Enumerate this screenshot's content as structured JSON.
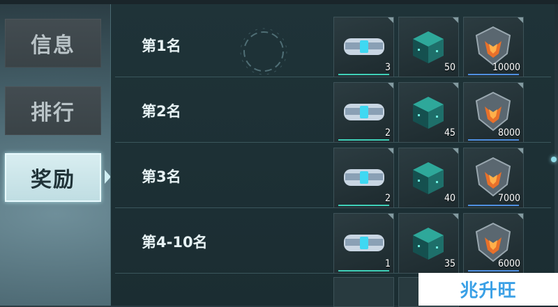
{
  "tabs": [
    {
      "label": "信息",
      "active": false
    },
    {
      "label": "排行",
      "active": false
    },
    {
      "label": "奖励",
      "active": true
    }
  ],
  "rewards": [
    {
      "rank": "第1名",
      "items": [
        {
          "icon": "chip-capsule-icon",
          "count": "3"
        },
        {
          "icon": "teal-cube-icon",
          "count": "50"
        },
        {
          "icon": "rank-emblem-icon",
          "count": "10000"
        }
      ]
    },
    {
      "rank": "第2名",
      "items": [
        {
          "icon": "chip-capsule-icon",
          "count": "2"
        },
        {
          "icon": "teal-cube-icon",
          "count": "45"
        },
        {
          "icon": "rank-emblem-icon",
          "count": "8000"
        }
      ]
    },
    {
      "rank": "第3名",
      "items": [
        {
          "icon": "chip-capsule-icon",
          "count": "2"
        },
        {
          "icon": "teal-cube-icon",
          "count": "40"
        },
        {
          "icon": "rank-emblem-icon",
          "count": "7000"
        }
      ]
    },
    {
      "rank": "第4-10名",
      "items": [
        {
          "icon": "chip-capsule-icon",
          "count": "1"
        },
        {
          "icon": "teal-cube-icon",
          "count": "35"
        },
        {
          "icon": "rank-emblem-icon",
          "count": "6000"
        }
      ]
    }
  ],
  "watermark": "兆升旺",
  "colors": {
    "item_bar_teal": "#3fd0b8",
    "item_bar_blue": "#4f8fe0",
    "active_tab": "#cfe9ee"
  }
}
